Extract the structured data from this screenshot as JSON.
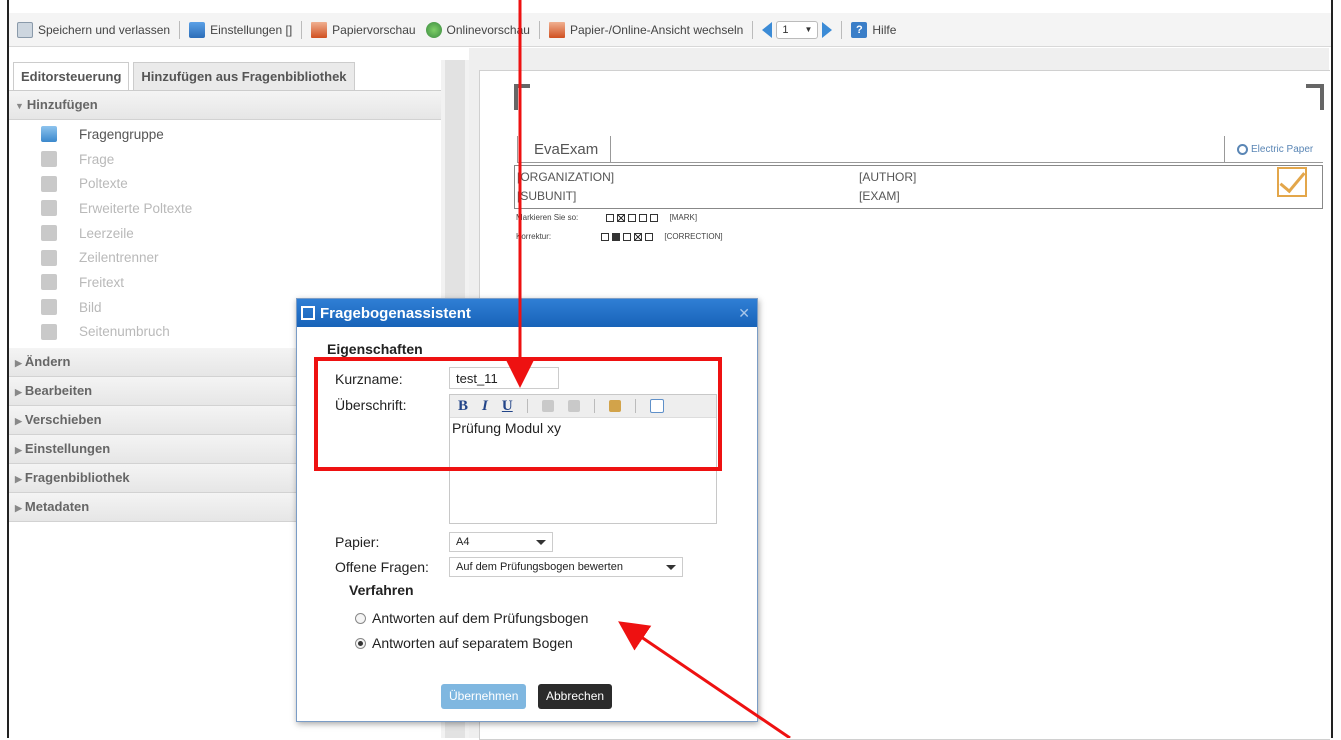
{
  "toolbar": {
    "save": "Speichern und verlassen",
    "settings": "Einstellungen []",
    "paper_preview": "Papiervorschau",
    "online_preview": "Onlinevorschau",
    "switch_view": "Papier-/Online-Ansicht wechseln",
    "page": "1",
    "help": "Hilfe"
  },
  "left_panel": {
    "tabs": [
      "Editorsteuerung",
      "Hinzufügen aus Fragenbibliothek"
    ],
    "sections": {
      "add": "Hinzufügen",
      "change": "Ändern",
      "edit": "Bearbeiten",
      "move": "Verschieben",
      "settings": "Einstellungen",
      "library": "Fragenbibliothek",
      "metadata": "Metadaten"
    },
    "add_items": [
      "Fragengruppe",
      "Frage",
      "Poltexte",
      "Erweiterte Poltexte",
      "Leerzeile",
      "Zeilentrenner",
      "Freitext",
      "Bild",
      "Seitenumbruch"
    ]
  },
  "preview": {
    "title": "EvaExam",
    "logo": "Electric Paper",
    "organization": "[ORGANIZATION]",
    "author": "[AUTHOR]",
    "subunit": "[SUBUNIT]",
    "exam": "[EXAM]",
    "mark_label": "Markieren Sie so:",
    "mark_tag": "[MARK]",
    "correction_label": "Korrektur:",
    "correction_tag": "[CORRECTION]"
  },
  "dialog": {
    "title": "Fragebogenassistent",
    "section": "Eigenschaften",
    "shortname_label": "Kurzname:",
    "shortname_value": "test_11",
    "heading_label": "Überschrift:",
    "heading_text": "Prüfung Modul xy",
    "paper_label": "Papier:",
    "paper_value": "A4",
    "open_label": "Offene Fragen:",
    "open_value": "Auf dem Prüfungsbogen bewerten",
    "procedure": "Verfahren",
    "radio1": "Antworten auf dem Prüfungsbogen",
    "radio2": "Antworten auf separatem Bogen",
    "ok": "Übernehmen",
    "cancel": "Abbrechen"
  },
  "colors": {
    "annotation": "#ee1111",
    "dialog_title": "#1f6fc8"
  }
}
